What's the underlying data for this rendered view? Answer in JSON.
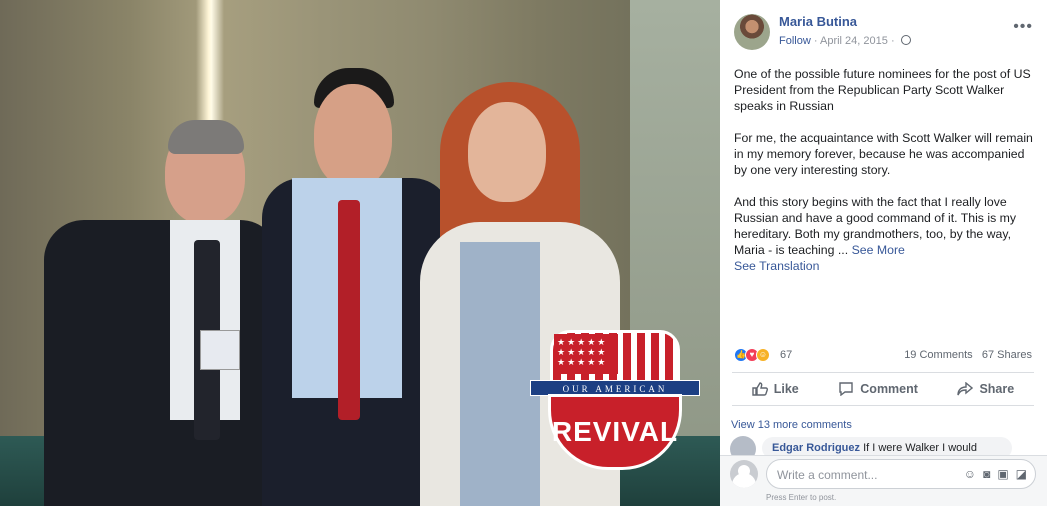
{
  "post": {
    "author": "Maria Butina",
    "follow_label": "Follow",
    "date": "April 24, 2015",
    "more_icon": "more-dots-icon",
    "paragraph_1": "One of the possible future nominees for the post of US President from the Republican Party Scott Walker speaks in Russian",
    "paragraph_2": "For me, the acquaintance with Scott Walker will remain in my memory forever, because he was accompanied by one very interesting story.",
    "paragraph_3": "And this story begins with the fact that I really love Russian and have a good command of it. This is my hereditary. Both my grandmothers, too, by the way, Maria - is teaching ...",
    "see_more": "See More",
    "see_translation": "See Translation"
  },
  "photo": {
    "logo_ribbon": "OUR AMERICAN",
    "logo_word": "REVIVAL"
  },
  "stats": {
    "reactions": "67",
    "comments": "19 Comments",
    "shares": "67 Shares"
  },
  "actions": {
    "like": "Like",
    "comment": "Comment",
    "share": "Share"
  },
  "comments": {
    "view_more": "View 13 more comments",
    "preview_author": "Edgar Rodriguez",
    "preview_text": "If I were Walker I would"
  },
  "composer": {
    "placeholder": "Write a comment...",
    "hint": "Press Enter to post."
  }
}
